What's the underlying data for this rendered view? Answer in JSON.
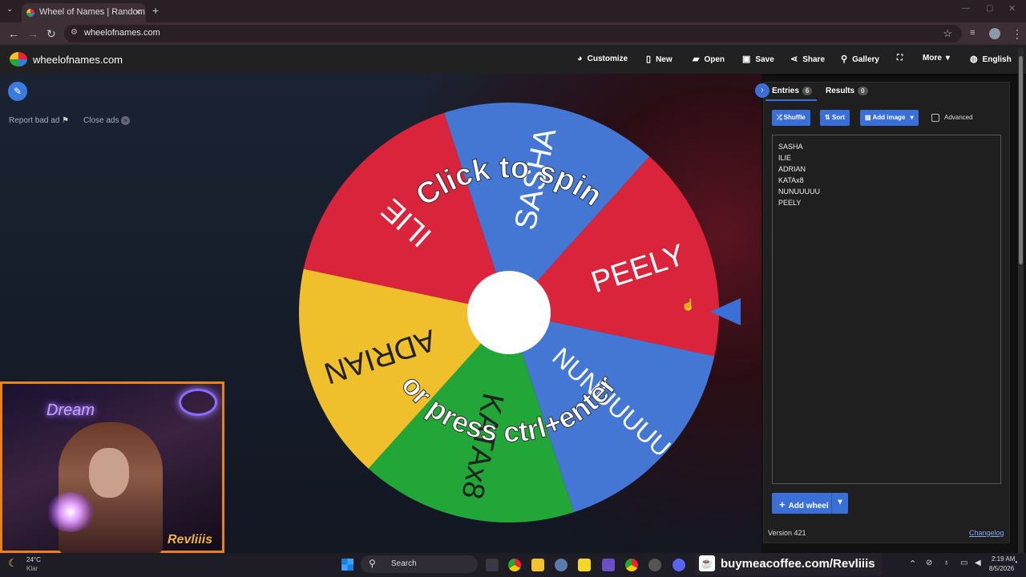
{
  "browser": {
    "tab_title": "Wheel of Names | Random name",
    "tab_close": "×",
    "new_tab": "+",
    "url": "wheelofnames.com"
  },
  "header": {
    "site_name": "wheelofnames.com",
    "buttons": {
      "customize": "Customize",
      "new": "New",
      "open": "Open",
      "save": "Save",
      "share": "Share",
      "gallery": "Gallery",
      "more": "More",
      "language": "English"
    }
  },
  "ads": {
    "report": "Report bad ad",
    "close": "Close ads"
  },
  "wheel": {
    "overlay_top": "Click to spin",
    "overlay_bottom": "or press ctrl+enter",
    "segments": [
      {
        "label": "SASHA",
        "color": "#4477d4"
      },
      {
        "label": "PEELY",
        "color": "#d9243c"
      },
      {
        "label": "NUNUUUUU",
        "color": "#4477d4"
      },
      {
        "label": "KATAx8",
        "color": "#22a638"
      },
      {
        "label": "ADRIAN",
        "color": "#f0bf2c"
      },
      {
        "label": "ILIE",
        "color": "#d9243c"
      }
    ]
  },
  "panel": {
    "tabs": {
      "entries": "Entries",
      "entries_count": "6",
      "results": "Results",
      "results_count": "0"
    },
    "toolbar": {
      "shuffle": "Shuffle",
      "sort": "Sort",
      "add_image": "Add image",
      "advanced": "Advanced"
    },
    "entries": [
      "SASHA",
      "ILIE",
      "ADRIAN",
      "KATAx8",
      "NUNUUUUU",
      "PEELY"
    ],
    "add_wheel": "Add wheel",
    "version": "Version 421",
    "changelog": "Changelog"
  },
  "webcam": {
    "neon_sign": "Dream",
    "streamer_tag": "Revliiis"
  },
  "taskbar": {
    "weather_temp": "24°C",
    "weather_desc": "Klar",
    "search": "Search",
    "coffee_link": "buymeacoffee.com/Revliiis",
    "time": "2:19 AM",
    "date": "8/5/2026"
  },
  "colors": {
    "accent": "#3b6fd8",
    "cam_border": "#e8821c"
  }
}
